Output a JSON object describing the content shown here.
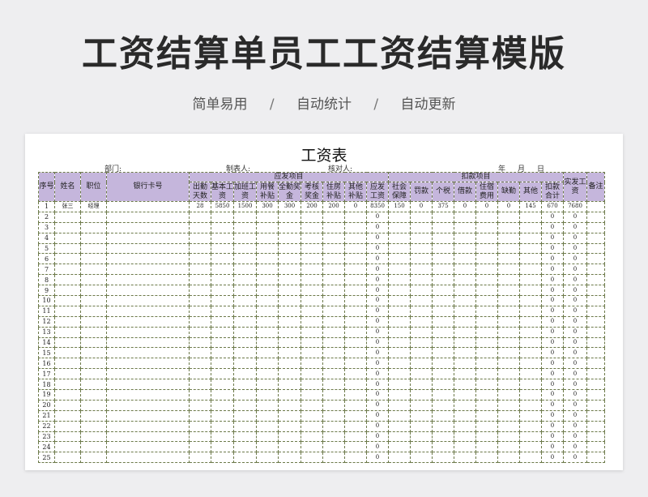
{
  "hero": {
    "title": "工资结算单员工工资结算模版",
    "features": [
      "简单易用",
      "自动统计",
      "自动更新"
    ],
    "separator": "/"
  },
  "sheet": {
    "title": "工资表",
    "dept_label": "部门:",
    "maker_label": "制表人:",
    "checker_label": "核对人:",
    "date_year": "年",
    "date_month": "月",
    "date_day": "日"
  },
  "table": {
    "headers": {
      "seq": "序号",
      "name": "姓名",
      "position": "职位",
      "bank_card": "银行卡号",
      "payable_group": "应发项目",
      "deduct_group": "扣款项目",
      "net_pay": "实发工资",
      "remark": "备注",
      "payable_cols": [
        "出勤天数",
        "基本工资",
        "加班工资",
        "用餐补贴",
        "全勤奖金",
        "考核奖金",
        "住房补贴",
        "其他补贴",
        "应发工资"
      ],
      "deduct_cols": [
        "社会保障",
        "罚款",
        "个税",
        "借款",
        "住宿费用",
        "缺勤",
        "其他",
        "扣款合计"
      ]
    },
    "first_row": {
      "seq": "1",
      "name": "张三",
      "position": "经理",
      "bank_card": "",
      "payable": [
        "28",
        "5850",
        "1500",
        "300",
        "300",
        "200",
        "200",
        "0",
        "8350"
      ],
      "deduct": [
        "150",
        "0",
        "375",
        "0",
        "0",
        "0",
        "145",
        "670"
      ],
      "net_pay": "7680",
      "remark": ""
    },
    "empty_row_count": 24,
    "empty_row_zero": "0"
  },
  "colors": {
    "header_bg": "#c5b6dc",
    "border": "#6d7a4a"
  }
}
